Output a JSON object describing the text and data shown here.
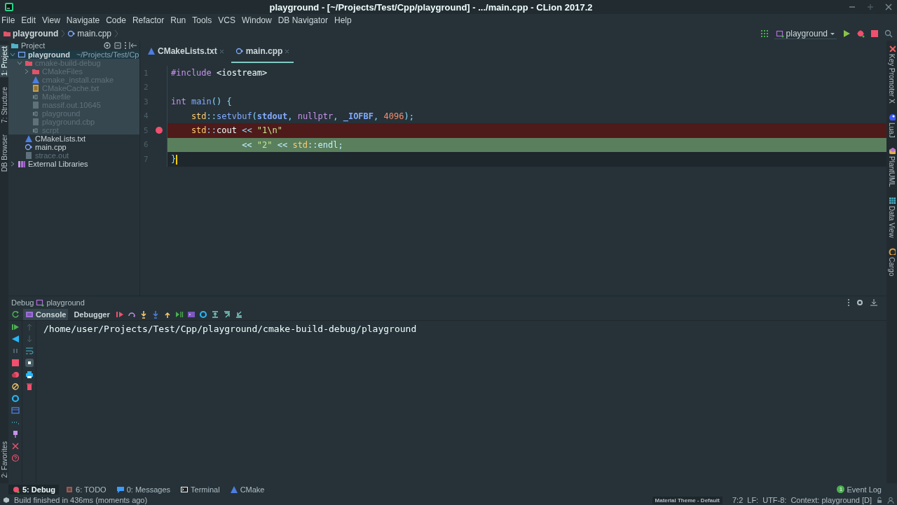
{
  "window": {
    "title": "playground - [~/Projects/Test/Cpp/playground] - .../main.cpp - CLion 2017.2"
  },
  "menu": [
    "File",
    "Edit",
    "View",
    "Navigate",
    "Code",
    "Refactor",
    "Run",
    "Tools",
    "VCS",
    "Window",
    "DB Navigator",
    "Help"
  ],
  "breadcrumb": [
    {
      "label": "playground",
      "kind": "folder"
    },
    {
      "label": "main.cpp",
      "kind": "cpp"
    }
  ],
  "run_config": {
    "label": "playground"
  },
  "left_strip": [
    {
      "label": "1: Project",
      "selected": true
    },
    {
      "label": "7: Structure",
      "selected": false
    },
    {
      "label": "DB Browser",
      "selected": false
    }
  ],
  "left_strip_bottom": [
    {
      "label": "2: Favorites",
      "selected": false
    }
  ],
  "right_strip": [
    {
      "label": "Key Promoter X"
    },
    {
      "label": "LuaJ"
    },
    {
      "label": "PlantUML"
    },
    {
      "label": "Data View"
    },
    {
      "label": "Cargo"
    }
  ],
  "project": {
    "title": "Project",
    "tree": [
      {
        "name": "playground",
        "path": "~/Projects/Test/Cp",
        "kind": "module",
        "expanded": true,
        "selected": true,
        "excluded": false,
        "children": [
          {
            "name": "cmake-build-debug",
            "kind": "folder",
            "expanded": true,
            "selected": false,
            "excluded": true,
            "children": [
              {
                "name": "CMakeFiles",
                "kind": "folder",
                "expanded": false,
                "selected": false,
                "excluded": true
              },
              {
                "name": "cmake_install.cmake",
                "kind": "cmake",
                "selected": false,
                "excluded": true
              },
              {
                "name": "CMakeCache.txt",
                "kind": "text",
                "selected": false,
                "excluded": true
              },
              {
                "name": "Makefile",
                "kind": "binary",
                "selected": false,
                "excluded": true
              },
              {
                "name": "massif.out.10645",
                "kind": "file",
                "selected": false,
                "excluded": true
              },
              {
                "name": "playground",
                "kind": "binary",
                "selected": false,
                "excluded": true
              },
              {
                "name": "playground.cbp",
                "kind": "file",
                "selected": false,
                "excluded": true
              },
              {
                "name": "scrpt",
                "kind": "binary",
                "selected": false,
                "excluded": true
              }
            ]
          },
          {
            "name": "CMakeLists.txt",
            "kind": "cmake",
            "selected": false,
            "excluded": false
          },
          {
            "name": "main.cpp",
            "kind": "cpp",
            "selected": false,
            "excluded": false
          },
          {
            "name": "strace.out",
            "kind": "file",
            "selected": false,
            "excluded": true
          }
        ]
      },
      {
        "name": "External Libraries",
        "kind": "library",
        "expanded": false,
        "selected": false,
        "excluded": false
      }
    ]
  },
  "editor": {
    "tabs": [
      {
        "label": "CMakeLists.txt",
        "kind": "cmake",
        "selected": false
      },
      {
        "label": "main.cpp",
        "kind": "cpp",
        "selected": true
      }
    ],
    "lines": [
      {
        "number": "1",
        "kind": "normal",
        "breakpoint": false,
        "tokens": [
          {
            "text": "#include",
            "kind": "kw"
          },
          {
            "text": " <iostream>",
            "kind": "plain"
          }
        ]
      },
      {
        "number": "2",
        "kind": "normal",
        "breakpoint": false
      },
      {
        "number": "3",
        "kind": "normal",
        "breakpoint": false,
        "tokens": [
          {
            "text": "int",
            "kind": "kw"
          },
          {
            "text": " main",
            "kind": "fn"
          },
          {
            "text": "() {",
            "kind": "punct"
          }
        ]
      },
      {
        "number": "4",
        "kind": "normal",
        "breakpoint": false,
        "tokens": [
          {
            "text": "    std",
            "kind": "type"
          },
          {
            "text": "::",
            "kind": "punct"
          },
          {
            "text": "setvbuf",
            "kind": "fn"
          },
          {
            "text": "(",
            "kind": "punct"
          },
          {
            "text": "stdout",
            "kind": "bold"
          },
          {
            "text": ", ",
            "kind": "punct"
          },
          {
            "text": "nullptr",
            "kind": "kw"
          },
          {
            "text": ", ",
            "kind": "punct"
          },
          {
            "text": "_IOFBF",
            "kind": "bold"
          },
          {
            "text": ", ",
            "kind": "punct"
          },
          {
            "text": "4096",
            "kind": "num"
          },
          {
            "text": ");",
            "kind": "punct"
          }
        ]
      },
      {
        "number": "5",
        "kind": "breakpoint",
        "breakpoint": true,
        "tokens": [
          {
            "text": "    std",
            "kind": "type"
          },
          {
            "text": "::",
            "kind": "punct"
          },
          {
            "text": "cout ",
            "kind": "plain"
          },
          {
            "text": "<< ",
            "kind": "punct"
          },
          {
            "text": "\"1\\n\"",
            "kind": "str"
          }
        ]
      },
      {
        "number": "6",
        "kind": "execution",
        "breakpoint": false,
        "tokens": [
          {
            "text": "              << ",
            "kind": "punct"
          },
          {
            "text": "\"2\"",
            "kind": "str"
          },
          {
            "text": " << ",
            "kind": "punct"
          },
          {
            "text": "std",
            "kind": "type"
          },
          {
            "text": "::",
            "kind": "punct"
          },
          {
            "text": "endl",
            "kind": "fn"
          },
          {
            "text": ";",
            "kind": "punct"
          }
        ]
      },
      {
        "number": "7",
        "kind": "caret",
        "breakpoint": false,
        "tokens": [
          {
            "text": "}",
            "kind": "punct"
          }
        ]
      }
    ]
  },
  "debug": {
    "title": "Debug",
    "config": "playground",
    "tabs": [
      {
        "label": "Console",
        "selected": true
      },
      {
        "label": "Debugger",
        "selected": false
      }
    ],
    "console": [
      "/home/user/Projects/Test/Cpp/playground/cmake-build-debug/playground"
    ]
  },
  "tool_tabs": [
    {
      "label": "5: Debug",
      "kind": "debug",
      "selected": true
    },
    {
      "label": "6: TODO",
      "kind": "todo",
      "selected": false
    },
    {
      "label": "0: Messages",
      "kind": "messages",
      "selected": false
    },
    {
      "label": "Terminal",
      "kind": "terminal",
      "selected": false
    },
    {
      "label": "CMake",
      "kind": "cmake",
      "selected": false
    }
  ],
  "event_log": {
    "label": "Event Log",
    "count": "1"
  },
  "status_bar": {
    "message": "Build finished in 436ms (moments ago)",
    "theme": "Material Theme - Default",
    "items": [
      "7:2",
      "LF:",
      "UTF-8:",
      "Context: playground [D]"
    ]
  }
}
